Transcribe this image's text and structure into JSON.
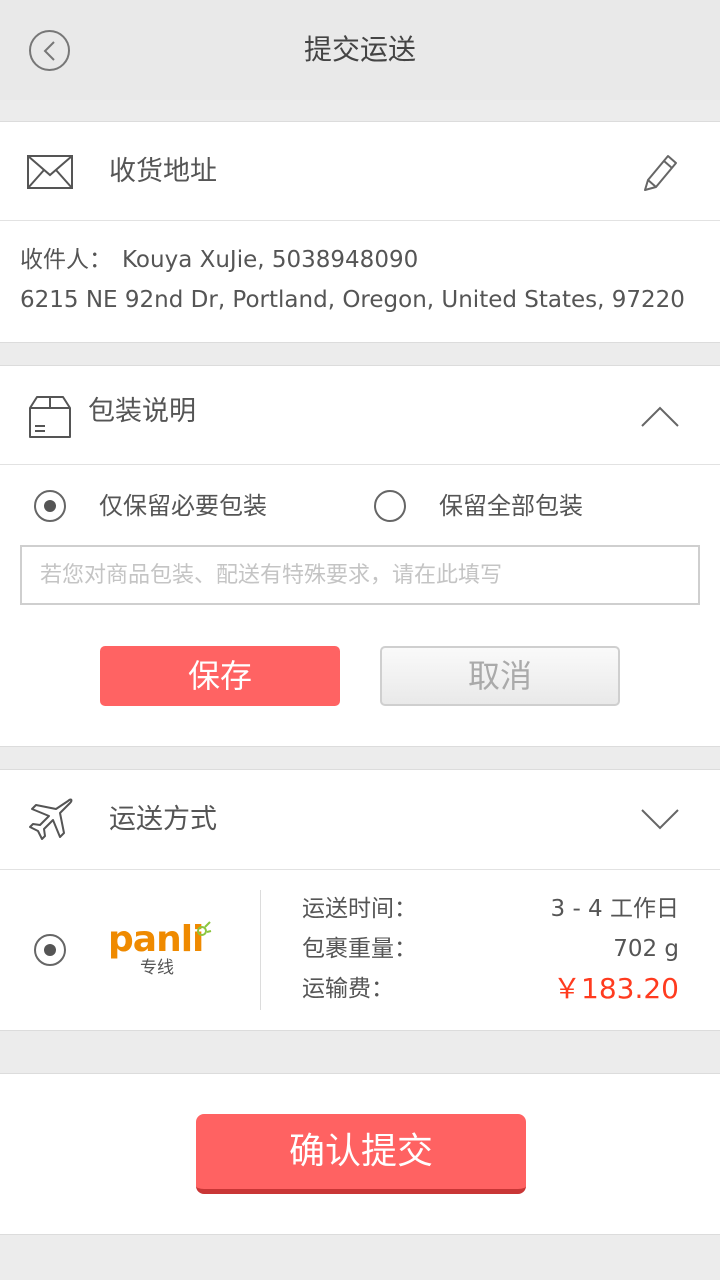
{
  "header": {
    "title": "提交运送",
    "back_icon": "chevron-left-icon"
  },
  "address": {
    "title": "收货地址",
    "recipient_label": "收件人：",
    "recipient_value": "Kouya XuJie, 5038948090",
    "street": "6215 NE 92nd Dr, Portland, Oregon, United States, 97220"
  },
  "packaging": {
    "title": "包装说明",
    "options": [
      {
        "label": "仅保留必要包装",
        "selected": true
      },
      {
        "label": "保留全部包装",
        "selected": false
      }
    ],
    "note_placeholder": "若您对商品包装、配送有特殊要求，请在此填写",
    "note_value": "",
    "save_label": "保存",
    "cancel_label": "取消"
  },
  "shipping": {
    "title": "运送方式",
    "method": {
      "logo_text": "panli",
      "logo_sub": "专线",
      "selected": true,
      "time_label": "运送时间：",
      "time_value": "3 - 4 工作日",
      "weight_label": "包裹重量：",
      "weight_value": "702 g",
      "fee_label": "运输费：",
      "fee_value": "￥183.20"
    }
  },
  "submit_label": "确认提交",
  "colors": {
    "accent": "#ff6363",
    "price": "#ff3b1f",
    "logo": "#ef8a00",
    "logo_leaf": "#8cc63f"
  }
}
